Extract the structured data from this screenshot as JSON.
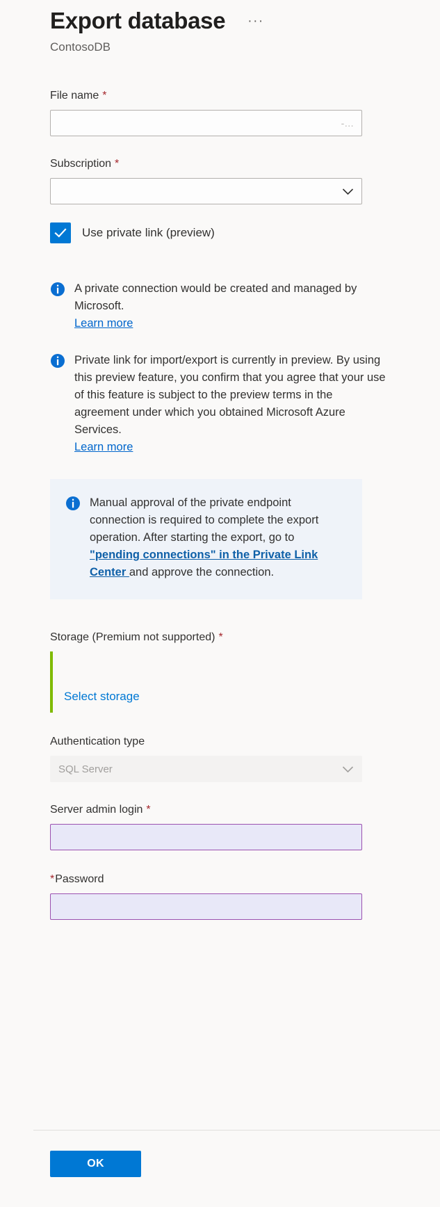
{
  "header": {
    "title": "Export database",
    "subtitle": "ContosoDB",
    "more_label": "···"
  },
  "fields": {
    "file_name": {
      "label": "File name",
      "required_mark": "*",
      "value": "",
      "suffix": "-..."
    },
    "subscription": {
      "label": "Subscription",
      "required_mark": "*",
      "value": ""
    },
    "private_link_checkbox": {
      "label": "Use private link (preview)",
      "checked": true,
      "check_glyph": "✓"
    },
    "storage": {
      "label": "Storage (Premium not supported)",
      "required_mark": "*",
      "select_link": "Select storage"
    },
    "authentication_type": {
      "label": "Authentication type",
      "value": "SQL Server",
      "disabled": true
    },
    "server_admin_login": {
      "label": "Server admin login",
      "required_mark": "*",
      "value": ""
    },
    "password": {
      "label": "Password",
      "required_mark": "*",
      "value": ""
    }
  },
  "messages": {
    "private_connection": {
      "text": "A private connection would be created and managed by Microsoft.",
      "link": "Learn more"
    },
    "preview_terms": {
      "text": "Private link for import/export is currently in preview. By using this preview feature, you confirm that you agree that your use of this feature is subject to the preview terms in the agreement under which you obtained Microsoft Azure Services.",
      "link": "Learn more"
    },
    "manual_approval": {
      "text_before": "Manual approval of the private endpoint connection is required to complete the export operation. After starting the export, go to ",
      "link_text": "\"pending connections\" in the Private Link Center ",
      "text_after": "and approve the connection."
    }
  },
  "footer": {
    "ok_label": "OK"
  },
  "colors": {
    "accent": "#0078d4",
    "required": "#a4262c",
    "info_icon": "#0a6ed1",
    "info_box_bg": "#eff3f9",
    "storage_accent": "#7fba00",
    "autofill_border": "#9b51b0",
    "autofill_bg": "#e8e8f8",
    "page_bg": "#faf9f8"
  }
}
